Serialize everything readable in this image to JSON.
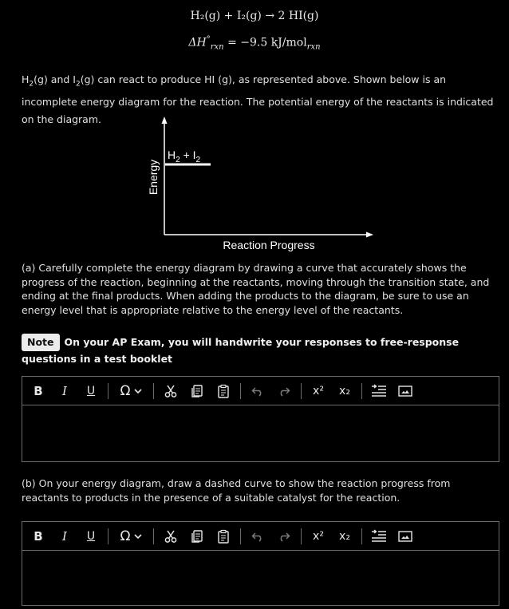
{
  "equation": {
    "line1": "H₂(g) + I₂(g) → 2 HI(g)",
    "line2_prefix": "ΔH",
    "line2_sup": "°",
    "line2_sub": "rxn",
    "line2_mid": " = −9.5 kJ/mol",
    "line2_sub2": "rxn"
  },
  "intro": {
    "text1": "H",
    "s1": "2",
    "text2": "(g) and I",
    "s2": "2",
    "text3": "(g) can react to produce HI (g), as represented above. Shown below is an incomplete energy diagram for the reaction. The potential energy of the reactants is indicated on the diagram."
  },
  "diagram": {
    "y_label": "Energy",
    "x_label": "Reaction Progress",
    "reactant_label_a": "H",
    "reactant_sub_a": "2",
    "reactant_label_mid": " + I",
    "reactant_sub_b": "2"
  },
  "part_a": "(a) Carefully complete the energy diagram by drawing a curve that accurately shows the progress of the reaction, beginning at the reactants, moving through the transition state, and ending at the final products. When adding the products to the diagram, be sure to use an energy level that is appropriate relative to the energy level of the reactants.",
  "note": {
    "badge": "Note",
    "text": "On your AP Exam, you will handwrite your responses to free-response questions in a test booklet"
  },
  "toolbar": {
    "bold": "B",
    "italic": "I",
    "underline": "U",
    "omega": "Ω",
    "superscript": "x²",
    "subscript": "x₂"
  },
  "part_b": "(b) On your energy diagram, draw a dashed curve to show the reaction progress from reactants to products in the presence of a suitable catalyst for the reaction."
}
